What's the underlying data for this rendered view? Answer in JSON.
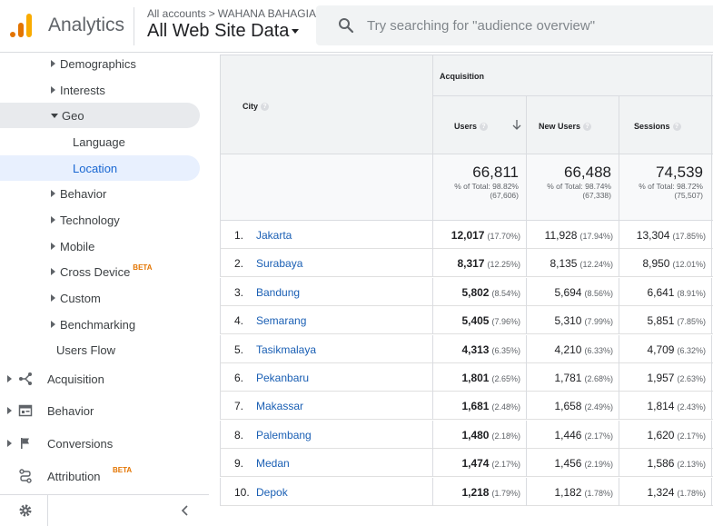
{
  "header": {
    "app_name": "Analytics",
    "crumb_root": "All accounts",
    "crumb_sep": ">",
    "crumb_account": "WAHANA BAHAGIA",
    "view_name": "All Web Site Data",
    "search_placeholder": "Try searching for \"audience overview\""
  },
  "sidebar": {
    "sub_items": [
      {
        "label": "Demographics",
        "arrow": "right"
      },
      {
        "label": "Interests",
        "arrow": "right"
      },
      {
        "label": "Geo",
        "arrow": "down"
      },
      {
        "label": "Language",
        "arrow": "none"
      },
      {
        "label": "Location",
        "arrow": "none",
        "active": true
      },
      {
        "label": "Behavior",
        "arrow": "right"
      },
      {
        "label": "Technology",
        "arrow": "right"
      },
      {
        "label": "Mobile",
        "arrow": "right"
      },
      {
        "label": "Cross Device",
        "arrow": "right",
        "badge": "BETA"
      },
      {
        "label": "Custom",
        "arrow": "right"
      },
      {
        "label": "Benchmarking",
        "arrow": "right"
      },
      {
        "label": "Users Flow",
        "arrow": "none"
      }
    ],
    "sections": [
      {
        "label": "Acquisition",
        "icon": "acquisition-icon"
      },
      {
        "label": "Behavior",
        "icon": "behavior-icon"
      },
      {
        "label": "Conversions",
        "icon": "flag-icon"
      },
      {
        "label": "Attribution",
        "icon": "attribution-icon",
        "badge": "BETA"
      }
    ]
  },
  "table": {
    "dim_header": "City",
    "group_header": "Acquisition",
    "metric_headers": [
      "Users",
      "New Users",
      "Sessions"
    ],
    "totals": [
      {
        "value": "66,811",
        "pct": "% of Total: 98.82%",
        "base": "(67,606)"
      },
      {
        "value": "66,488",
        "pct": "% of Total: 98.74%",
        "base": "(67,338)"
      },
      {
        "value": "74,539",
        "pct": "% of Total: 98.72%",
        "base": "(75,507)"
      }
    ],
    "rows": [
      {
        "idx": "1.",
        "city": "Jakarta",
        "users": "12,017",
        "users_pct": "(17.70%)",
        "new": "11,928",
        "new_pct": "(17.94%)",
        "sessions": "13,304",
        "sessions_pct": "(17.85%)"
      },
      {
        "idx": "2.",
        "city": "Surabaya",
        "users": "8,317",
        "users_pct": "(12.25%)",
        "new": "8,135",
        "new_pct": "(12.24%)",
        "sessions": "8,950",
        "sessions_pct": "(12.01%)"
      },
      {
        "idx": "3.",
        "city": "Bandung",
        "users": "5,802",
        "users_pct": "(8.54%)",
        "new": "5,694",
        "new_pct": "(8.56%)",
        "sessions": "6,641",
        "sessions_pct": "(8.91%)"
      },
      {
        "idx": "4.",
        "city": "Semarang",
        "users": "5,405",
        "users_pct": "(7.96%)",
        "new": "5,310",
        "new_pct": "(7.99%)",
        "sessions": "5,851",
        "sessions_pct": "(7.85%)"
      },
      {
        "idx": "5.",
        "city": "Tasikmalaya",
        "users": "4,313",
        "users_pct": "(6.35%)",
        "new": "4,210",
        "new_pct": "(6.33%)",
        "sessions": "4,709",
        "sessions_pct": "(6.32%)"
      },
      {
        "idx": "6.",
        "city": "Pekanbaru",
        "users": "1,801",
        "users_pct": "(2.65%)",
        "new": "1,781",
        "new_pct": "(2.68%)",
        "sessions": "1,957",
        "sessions_pct": "(2.63%)"
      },
      {
        "idx": "7.",
        "city": "Makassar",
        "users": "1,681",
        "users_pct": "(2.48%)",
        "new": "1,658",
        "new_pct": "(2.49%)",
        "sessions": "1,814",
        "sessions_pct": "(2.43%)"
      },
      {
        "idx": "8.",
        "city": "Palembang",
        "users": "1,480",
        "users_pct": "(2.18%)",
        "new": "1,446",
        "new_pct": "(2.17%)",
        "sessions": "1,620",
        "sessions_pct": "(2.17%)"
      },
      {
        "idx": "9.",
        "city": "Medan",
        "users": "1,474",
        "users_pct": "(2.17%)",
        "new": "1,456",
        "new_pct": "(2.19%)",
        "sessions": "1,586",
        "sessions_pct": "(2.13%)"
      },
      {
        "idx": "10.",
        "city": "Depok",
        "users": "1,218",
        "users_pct": "(1.79%)",
        "new": "1,182",
        "new_pct": "(1.78%)",
        "sessions": "1,324",
        "sessions_pct": "(1.78%)"
      }
    ]
  },
  "colors": {
    "accent": "#1a73e8",
    "link": "#1a5fb4",
    "logo_orange": "#e37400",
    "logo_yellow": "#f9ab00",
    "beta": "#e37400"
  }
}
